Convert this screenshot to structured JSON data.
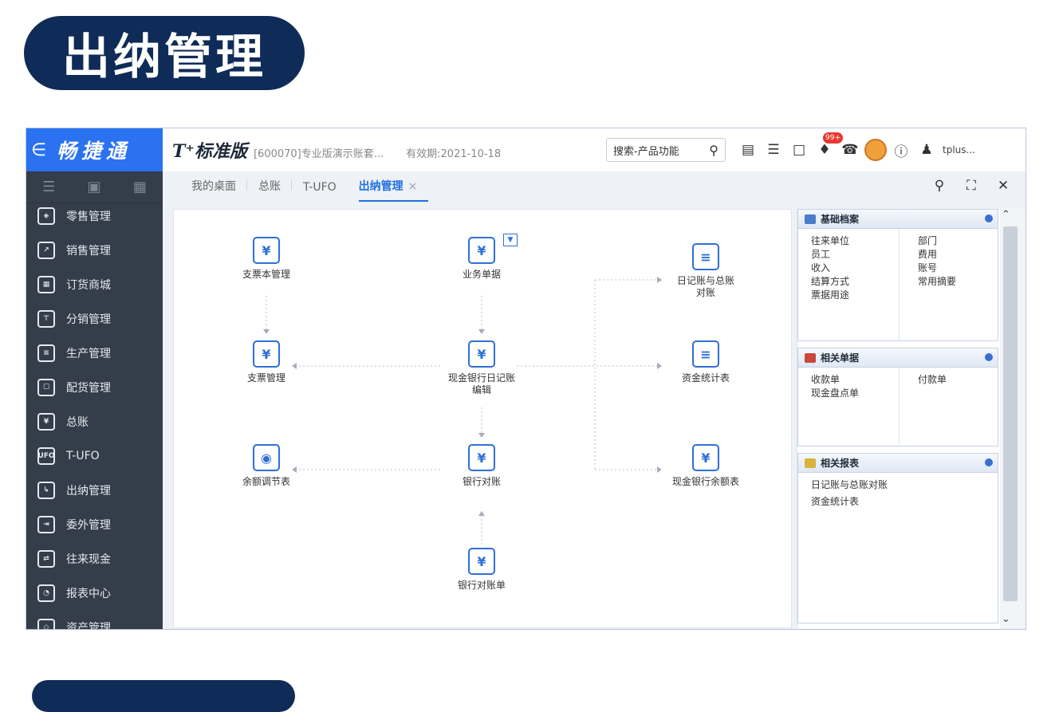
{
  "heading": "出纳管理",
  "logo": {
    "back_glyph": "∈",
    "name": "畅捷通"
  },
  "topbar": {
    "product": "T⁺标准版",
    "account": "[600070]专业版演示账套...",
    "validity": "有效期:2021-10-18",
    "search_label": "搜索-产品功能",
    "badge": "99+",
    "user": "tplus..."
  },
  "sidebar": {
    "items": [
      {
        "label": "零售管理",
        "icon": "retail-icon",
        "glyph": "◈"
      },
      {
        "label": "销售管理",
        "icon": "sales-chart-icon",
        "glyph": "↗"
      },
      {
        "label": "订货商城",
        "icon": "store-icon",
        "glyph": "▦"
      },
      {
        "label": "分销管理",
        "icon": "distribution-icon",
        "glyph": "⊤"
      },
      {
        "label": "生产管理",
        "icon": "production-icon",
        "glyph": "≡"
      },
      {
        "label": "配货管理",
        "icon": "allocation-icon",
        "glyph": "☐"
      },
      {
        "label": "总账",
        "icon": "ledger-icon",
        "glyph": "¥"
      },
      {
        "label": "T-UFO",
        "icon": "ufo-icon",
        "glyph": "UFO"
      },
      {
        "label": "出纳管理",
        "icon": "cashier-icon",
        "glyph": "↳"
      },
      {
        "label": "委外管理",
        "icon": "outsource-icon",
        "glyph": "⇥"
      },
      {
        "label": "往来现金",
        "icon": "cash-flow-icon",
        "glyph": "⇄"
      },
      {
        "label": "报表中心",
        "icon": "report-icon",
        "glyph": "◔"
      },
      {
        "label": "资产管理",
        "icon": "asset-icon",
        "glyph": "◇"
      }
    ]
  },
  "tabs": [
    {
      "label": "我的桌面"
    },
    {
      "label": "总账"
    },
    {
      "label": "T-UFO"
    },
    {
      "label": "出纳管理",
      "close": "×"
    }
  ],
  "flow_nodes": {
    "cheque_book": "支票本管理",
    "business_docs": "业务单据",
    "journal_check": "日记账与总账对账",
    "cheque_mgmt": "支票管理",
    "journal_edit": "现金银行日记账编辑",
    "fund_stats": "资金统计表",
    "balance_adjust": "余额调节表",
    "bank_reconcile": "银行对账",
    "cash_bank_balance": "现金银行余额表",
    "bank_statement": "银行对账单"
  },
  "panels": {
    "basic": {
      "title": "基础档案",
      "left": [
        "往来单位",
        "员工",
        "收入",
        "结算方式",
        "票据用途"
      ],
      "right": [
        "部门",
        "费用",
        "账号",
        "常用摘要"
      ]
    },
    "docs": {
      "title": "相关单据",
      "left": [
        "收款单",
        "现金盘点单"
      ],
      "right": [
        "付款单"
      ]
    },
    "reports": {
      "title": "相关报表",
      "left": [
        "日记账与总账对账",
        "资金统计表"
      ],
      "right": []
    }
  },
  "colors": {
    "brand_blue": "#2a72f0",
    "sidebar": "#343d4a",
    "heading_bg": "#0f2b57",
    "accent": "#1f6fe5"
  }
}
